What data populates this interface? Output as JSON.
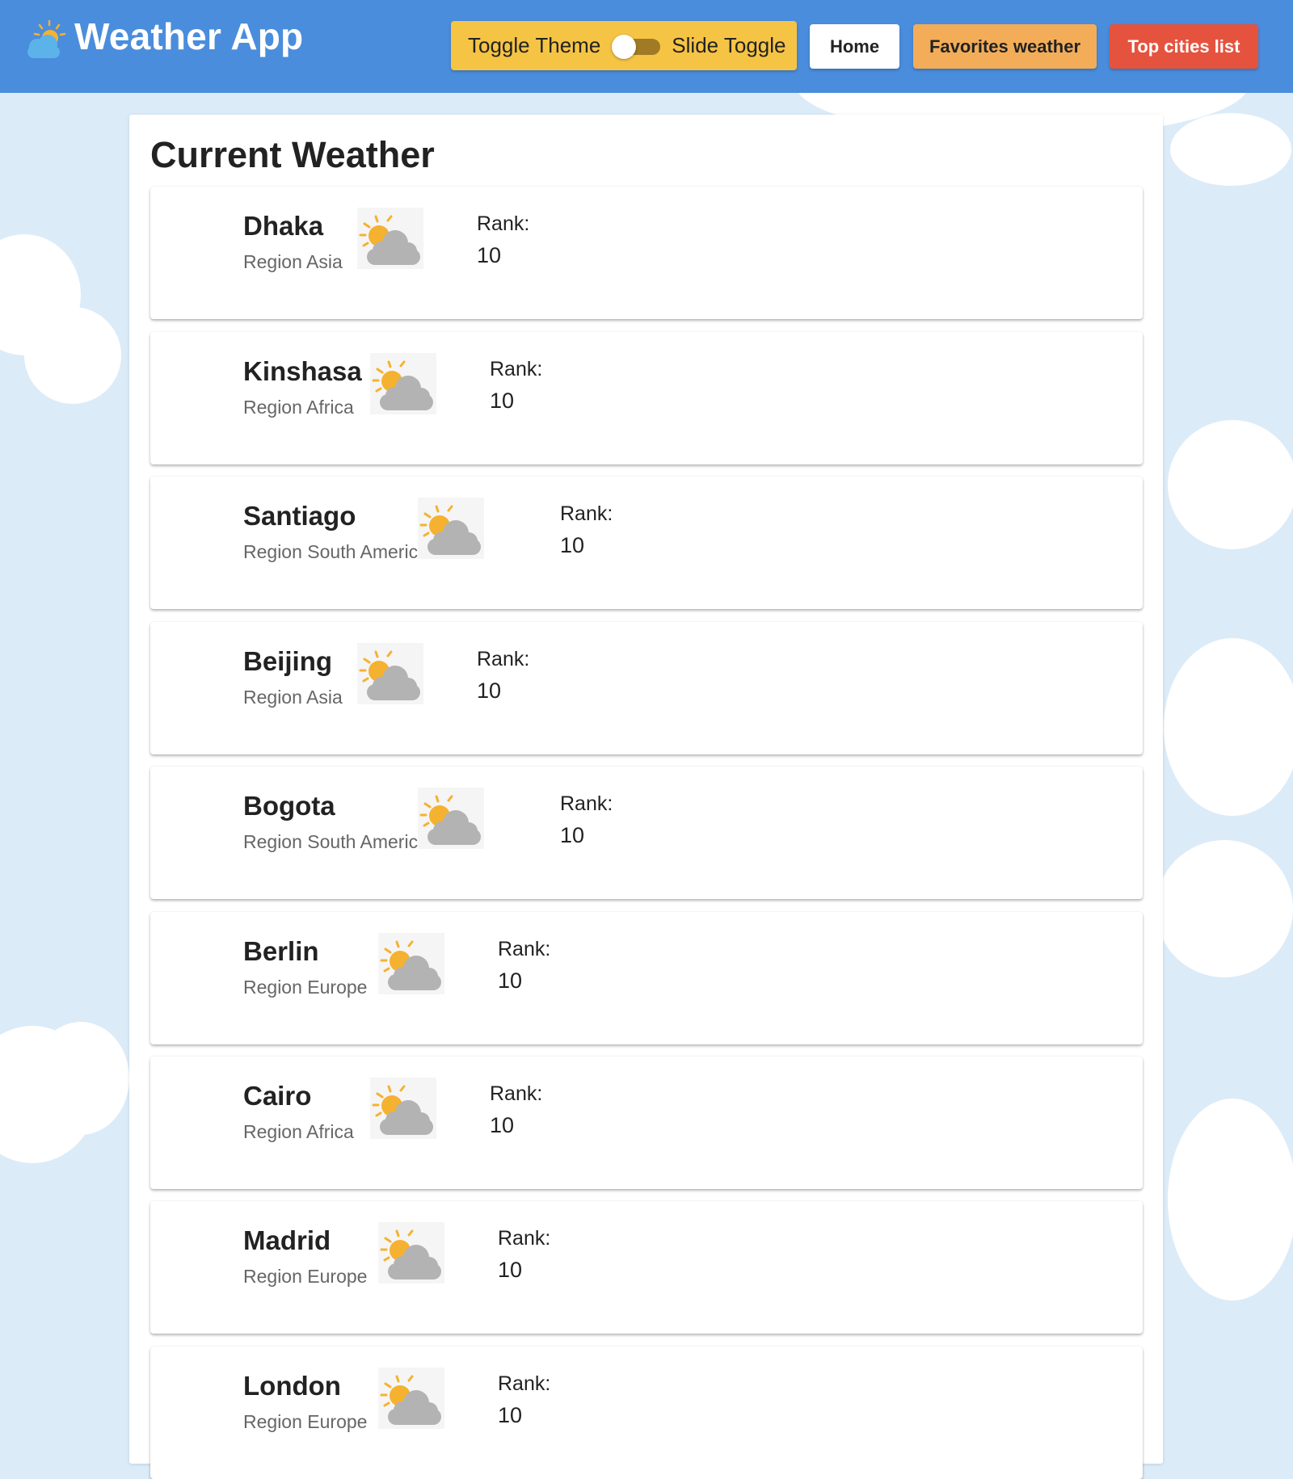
{
  "header": {
    "title": "Weather App",
    "logo_icon": "partly-cloudy-icon",
    "theme_toggle_label": "Toggle Theme",
    "slide_toggle_label": "Slide Toggle",
    "nav": {
      "home": "Home",
      "favorites": "Favorites weather",
      "top_cities": "Top cities list"
    }
  },
  "colors": {
    "header_bg": "#4a8ddc",
    "theme_button": "#f6c444",
    "favorites_button": "#f3ad58",
    "top_cities_button": "#e5533f",
    "page_bg": "#dcebf8"
  },
  "main": {
    "title": "Current Weather",
    "rank_label": "Rank:",
    "cities": [
      {
        "name": "Dhaka",
        "region": "Region Asia",
        "rank": "10",
        "icon": "partly-cloudy-icon"
      },
      {
        "name": "Kinshasa",
        "region": "Region Africa",
        "rank": "10",
        "icon": "partly-cloudy-icon"
      },
      {
        "name": "Santiago",
        "region": "Region South America",
        "rank": "10",
        "icon": "partly-cloudy-icon"
      },
      {
        "name": "Beijing",
        "region": "Region Asia",
        "rank": "10",
        "icon": "partly-cloudy-icon"
      },
      {
        "name": "Bogota",
        "region": "Region South America",
        "rank": "10",
        "icon": "partly-cloudy-icon"
      },
      {
        "name": "Berlin",
        "region": "Region Europe",
        "rank": "10",
        "icon": "partly-cloudy-icon"
      },
      {
        "name": "Cairo",
        "region": "Region Africa",
        "rank": "10",
        "icon": "partly-cloudy-icon"
      },
      {
        "name": "Madrid",
        "region": "Region Europe",
        "rank": "10",
        "icon": "partly-cloudy-icon"
      },
      {
        "name": "London",
        "region": "Region Europe",
        "rank": "10",
        "icon": "partly-cloudy-icon"
      }
    ]
  }
}
